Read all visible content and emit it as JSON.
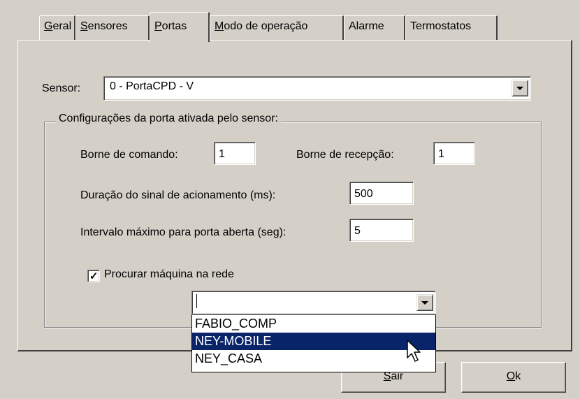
{
  "tabs": [
    {
      "mnemonic": "G",
      "rest": "eral"
    },
    {
      "mnemonic": "S",
      "rest": "ensores"
    },
    {
      "mnemonic": "P",
      "rest": "ortas"
    },
    {
      "mnemonic": "M",
      "rest": "odo de operação"
    },
    {
      "mnemonic": "",
      "rest": "Alarme"
    },
    {
      "mnemonic": "",
      "rest": "Termostatos"
    }
  ],
  "active_tab": "Portas",
  "sensor": {
    "label": "Sensor:",
    "value": "0 - PortaCPD - V"
  },
  "group": {
    "title": "Configurações da porta ativada pelo sensor:"
  },
  "fields": {
    "borne_comando": {
      "label": "Borne de comando:",
      "value": "1"
    },
    "borne_recepcao": {
      "label": "Borne de recepção:",
      "value": "1"
    },
    "duracao": {
      "label": "Duração do sinal de acionamento (ms):",
      "value": "500"
    },
    "intervalo": {
      "label": "Intervalo máximo para porta aberta (seg):",
      "value": "5"
    }
  },
  "procurar": {
    "label": "Procurar máquina na rede",
    "checked": true,
    "value": ""
  },
  "machine_list": {
    "items": [
      "FABIO_COMP",
      "NEY-MOBILE",
      "NEY_CASA"
    ],
    "selected_index": 1
  },
  "buttons": {
    "sair": {
      "mnemonic": "S",
      "rest": "air"
    },
    "ok": {
      "mnemonic": "O",
      "rest": "k"
    }
  },
  "colors": {
    "face": "#d4d0c8",
    "selection": "#0a246a"
  }
}
